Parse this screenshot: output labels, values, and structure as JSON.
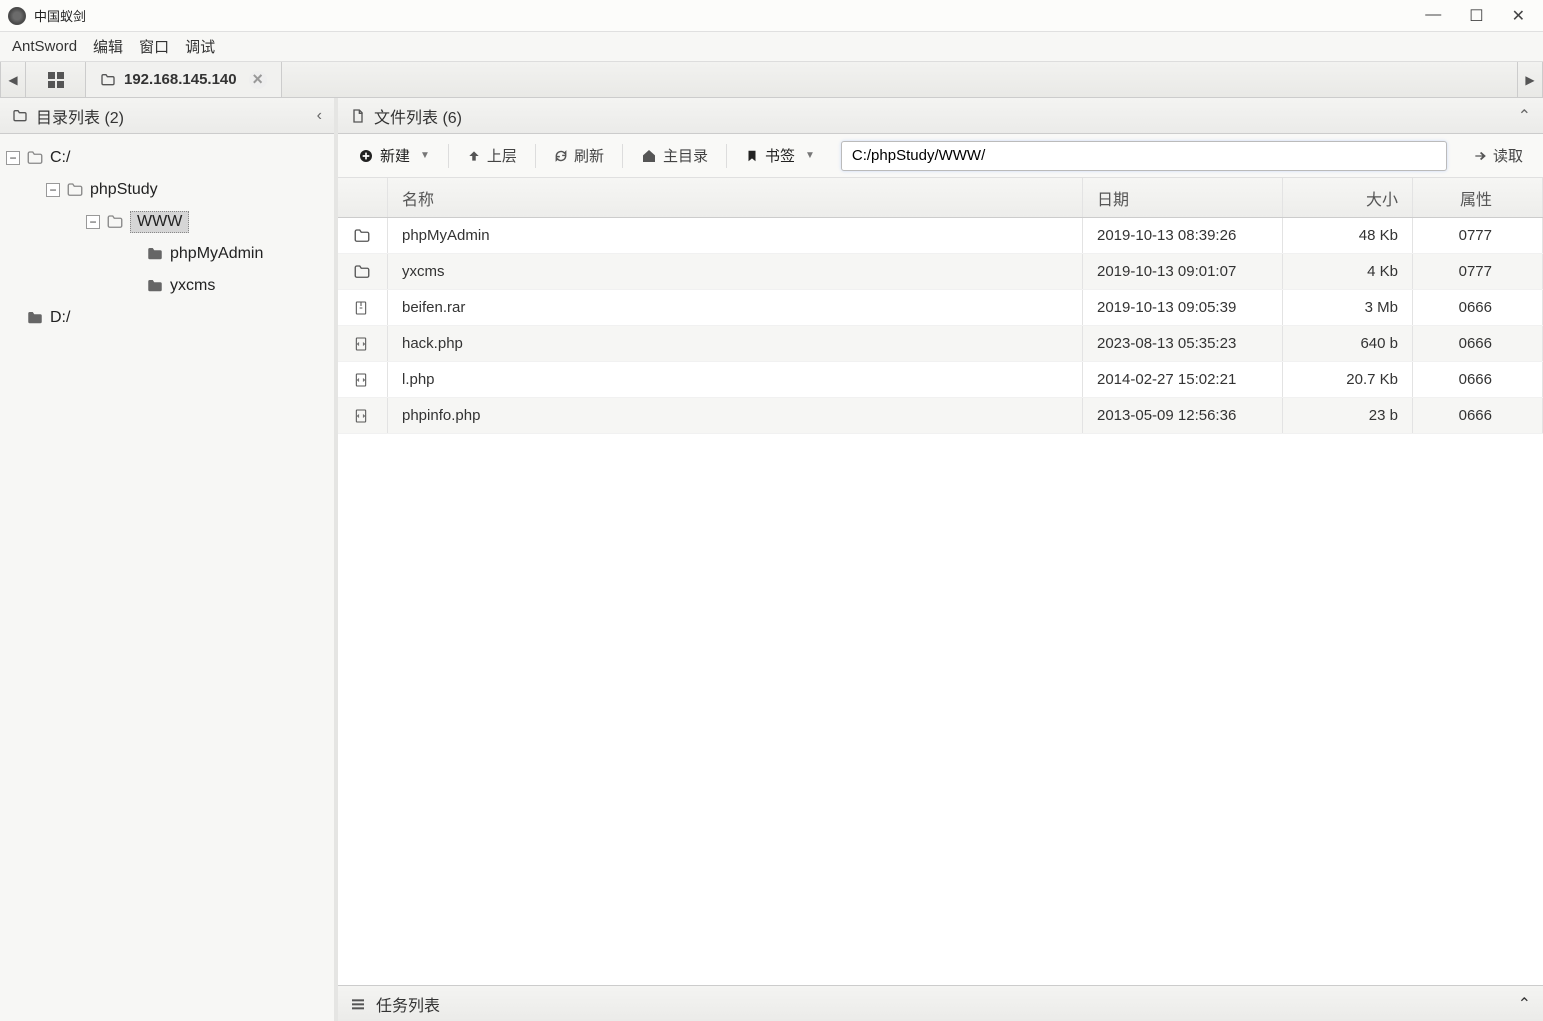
{
  "titlebar": {
    "title": "中国蚁剑"
  },
  "menubar": {
    "items": [
      "AntSword",
      "编辑",
      "窗口",
      "调试"
    ]
  },
  "tabs": {
    "active_label": "192.168.145.140"
  },
  "left_panel": {
    "title": "目录列表 (2)",
    "tree": [
      {
        "indent": 0,
        "toggle": "-",
        "icon": "folder",
        "label": "C:/",
        "selected": false
      },
      {
        "indent": 1,
        "toggle": "-",
        "icon": "folder",
        "label": "phpStudy",
        "selected": false
      },
      {
        "indent": 2,
        "toggle": "-",
        "icon": "folder",
        "label": "WWW",
        "selected": true
      },
      {
        "indent": 3,
        "toggle": "",
        "icon": "folder-solid",
        "label": "phpMyAdmin",
        "selected": false
      },
      {
        "indent": 3,
        "toggle": "",
        "icon": "folder-solid",
        "label": "yxcms",
        "selected": false
      },
      {
        "indent": 0,
        "toggle": "",
        "icon": "folder-solid",
        "label": "D:/",
        "selected": false
      }
    ]
  },
  "right_panel": {
    "title": "文件列表 (6)",
    "toolbar": {
      "new_label": "新建",
      "up_label": "上层",
      "refresh_label": "刷新",
      "home_label": "主目录",
      "bookmark_label": "书签",
      "read_label": "读取",
      "path_value": "C:/phpStudy/WWW/"
    },
    "columns": {
      "name": "名称",
      "date": "日期",
      "size": "大小",
      "attr": "属性"
    },
    "rows": [
      {
        "icon": "folder",
        "name": "phpMyAdmin",
        "date": "2019-10-13 08:39:26",
        "size": "48 Kb",
        "attr": "0777"
      },
      {
        "icon": "folder",
        "name": "yxcms",
        "date": "2019-10-13 09:01:07",
        "size": "4 Kb",
        "attr": "0777"
      },
      {
        "icon": "archive",
        "name": "beifen.rar",
        "date": "2019-10-13 09:05:39",
        "size": "3 Mb",
        "attr": "0666"
      },
      {
        "icon": "code",
        "name": "hack.php",
        "date": "2023-08-13 05:35:23",
        "size": "640 b",
        "attr": "0666"
      },
      {
        "icon": "code",
        "name": "l.php",
        "date": "2014-02-27 15:02:21",
        "size": "20.7 Kb",
        "attr": "0666"
      },
      {
        "icon": "code",
        "name": "phpinfo.php",
        "date": "2013-05-09 12:56:36",
        "size": "23 b",
        "attr": "0666"
      }
    ]
  },
  "task_panel": {
    "title": "任务列表"
  }
}
